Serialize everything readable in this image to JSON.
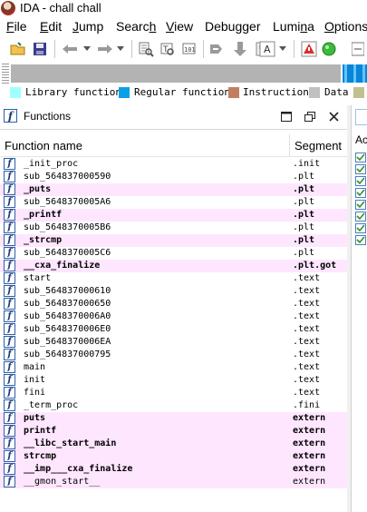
{
  "window": {
    "title": "IDA - chall chall"
  },
  "menu": [
    {
      "label": "File",
      "u": "F",
      "rest": "ile"
    },
    {
      "label": "Edit",
      "u": "E",
      "rest": "dit"
    },
    {
      "label": "Jump",
      "u": "J",
      "rest": "ump"
    },
    {
      "label": "Search",
      "pre": "Searc",
      "u": "h",
      "rest": ""
    },
    {
      "label": "View",
      "u": "V",
      "rest": "iew"
    },
    {
      "label": "Debugger",
      "pre": "Debu",
      "u": "g",
      "rest": "ger"
    },
    {
      "label": "Lumina",
      "pre": "Lumi",
      "u": "n",
      "rest": "a"
    },
    {
      "label": "Options",
      "u": "O",
      "rest": "ptions"
    }
  ],
  "legend": [
    {
      "label": "Library function",
      "color": "#a0ffff"
    },
    {
      "label": "Regular function",
      "color": "#0aa0e6"
    },
    {
      "label": "Instruction",
      "color": "#c08060"
    },
    {
      "label": "Data",
      "color": "#c0c0c0"
    }
  ],
  "functions_panel": {
    "title": "Functions",
    "col_name": "Function name",
    "col_segment": "Segment",
    "rows": [
      {
        "name": "_init_proc",
        "segment": ".init",
        "hl": false
      },
      {
        "name": "sub_564837000590",
        "segment": ".plt",
        "hl": false
      },
      {
        "name": "_puts",
        "segment": ".plt",
        "hl": true
      },
      {
        "name": "sub_5648370005A6",
        "segment": ".plt",
        "hl": false
      },
      {
        "name": "_printf",
        "segment": ".plt",
        "hl": true
      },
      {
        "name": "sub_5648370005B6",
        "segment": ".plt",
        "hl": false
      },
      {
        "name": "_strcmp",
        "segment": ".plt",
        "hl": true
      },
      {
        "name": "sub_5648370005C6",
        "segment": ".plt",
        "hl": false
      },
      {
        "name": "__cxa_finalize",
        "segment": ".plt.got",
        "hl": true
      },
      {
        "name": "start",
        "segment": ".text",
        "hl": false
      },
      {
        "name": "sub_564837000610",
        "segment": ".text",
        "hl": false
      },
      {
        "name": "sub_564837000650",
        "segment": ".text",
        "hl": false
      },
      {
        "name": "sub_5648370006A0",
        "segment": ".text",
        "hl": false
      },
      {
        "name": "sub_5648370006E0",
        "segment": ".text",
        "hl": false
      },
      {
        "name": "sub_5648370006EA",
        "segment": ".text",
        "hl": false
      },
      {
        "name": "sub_564837000795",
        "segment": ".text",
        "hl": false
      },
      {
        "name": "main",
        "segment": ".text",
        "hl": false
      },
      {
        "name": "init",
        "segment": ".text",
        "hl": false
      },
      {
        "name": "fini",
        "segment": ".text",
        "hl": false
      },
      {
        "name": "_term_proc",
        "segment": ".fini",
        "hl": false
      },
      {
        "name": "puts",
        "segment": "extern",
        "hl": true
      },
      {
        "name": "printf",
        "segment": "extern",
        "hl": true
      },
      {
        "name": "__libc_start_main",
        "segment": "extern",
        "hl": true
      },
      {
        "name": "strcmp",
        "segment": "extern",
        "hl": true
      },
      {
        "name": "__imp___cxa_finalize",
        "segment": "extern",
        "hl": true
      },
      {
        "name": "__gmon_start__",
        "segment": "extern",
        "hl": true,
        "normal": true
      }
    ]
  },
  "right_panel": {
    "label": "Ac"
  }
}
